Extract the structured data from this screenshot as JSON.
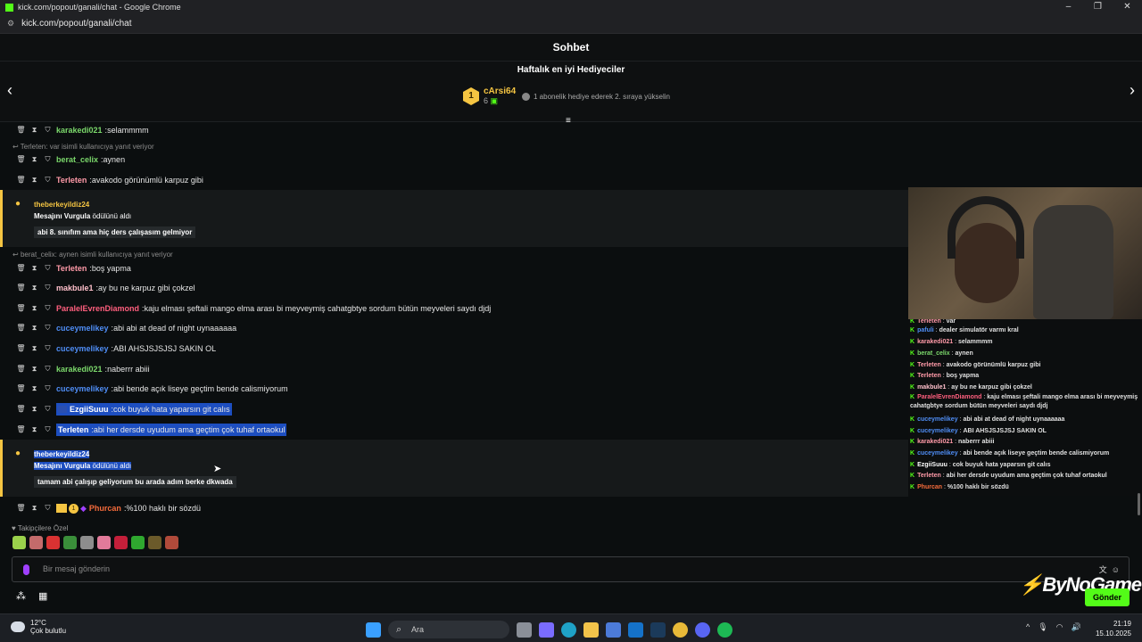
{
  "browser": {
    "window_title": "kick.com/popout/ganali/chat - Google Chrome",
    "url": "kick.com/popout/ganali/chat"
  },
  "header": {
    "title": "Sohbet"
  },
  "gifters": {
    "title": "Haftalık en iyi Hediyeciler",
    "top_rank": "1",
    "top_name": "cArsi64",
    "top_count": "6",
    "hint": "1 abonelik hediye ederek 2. sıraya yükselin"
  },
  "chat": {
    "messages": [
      {
        "user": "karakedi021",
        "text": "selammmm",
        "color": "#7bd86b"
      },
      {
        "user": "berat_celix",
        "text": "aynen",
        "color": "#7bd86b"
      },
      {
        "user": "Terleten",
        "text": "avakodo görünümlü karpuz gibi",
        "color": "#ff9aa8"
      },
      {
        "user": "Terleten",
        "text": "boş yapma",
        "color": "#ff9aa8"
      },
      {
        "user": "makbule1",
        "text": "ay bu ne karpuz gibi çokzel",
        "color": "#ffc0cb"
      },
      {
        "user": "ParalelEvrenDiamond",
        "text": "kaju elması şeftali mango elma arası bi meyveymiş cahatgbtye sordum bütün meyveleri saydı djdj",
        "color": "#ff5f7e"
      },
      {
        "user": "cuceymelikey",
        "text": "abi abi at dead of night uynaaaaaa",
        "color": "#4f8df5"
      },
      {
        "user": "cuceymelikey",
        "text": "ABI AHSJSJSJSJ SAKIN OL",
        "color": "#4f8df5"
      },
      {
        "user": "karakedi021",
        "text": "naberrr abiii",
        "color": "#7bd86b"
      },
      {
        "user": "cuceymelikey",
        "text": "abi bende açık liseye geçtim bende calismiyorum",
        "color": "#4f8df5"
      },
      {
        "user": "EzgiiSuuu",
        "text": "cok buyuk hata yaparsın git calıs",
        "color": "#ffffff"
      },
      {
        "user": "Terleten",
        "text": "abi her dersde uyudum ama geçtim çok tuhaf ortaokul",
        "color": "#ffffff"
      },
      {
        "user": "Phurcan",
        "text": "%100 haklı bir sözdü",
        "color": "#f56b3b"
      }
    ],
    "reply_1": "Terleten: var isimli kullanıcıya yanıt veriyor",
    "reply_2": "berat_celix: aynen isimli kullanıcıya yanıt veriyor",
    "highlight_1": {
      "user": "theberkeyildiz24",
      "reward": "Mesajını Vurgula",
      "reward_suffix": "ödülünü aldı",
      "body": "abi 8. sınıfım ama hiç ders çalışasım gelmiyor"
    },
    "highlight_2": {
      "user": "theberkeyildiz24",
      "reward": "Mesajını Vurgula",
      "reward_suffix": "ödülünü aldı",
      "body": "tamam abi çalışıp geliyorum bu arada adım berke dkwada"
    },
    "badge_number": "1"
  },
  "overlay_chat": [
    {
      "user": "Terleten",
      "text": "var"
    },
    {
      "user": "pafuli",
      "text": "dealer simulatör varmı kral"
    },
    {
      "user": "karakedi021",
      "text": "selammmm"
    },
    {
      "user": "berat_celix",
      "text": "aynen"
    },
    {
      "user": "Terleten",
      "text": "avakodo görünümlü karpuz gibi"
    },
    {
      "user": "Terleten",
      "text": "boş yapma"
    },
    {
      "user": "makbule1",
      "text": "ay bu ne karpuz gibi çokzel"
    },
    {
      "user": "ParalelEvrenDiamond",
      "text": "kaju elması şeftali mango elma arası bi meyveymiş cahatgbtye sordum bütün meyveleri saydı djdj"
    },
    {
      "user": "cuceymelikey",
      "text": "abi abi at dead of night uynaaaaaa"
    },
    {
      "user": "cuceymelikey",
      "text": "ABI AHSJSJSJSJ SAKIN OL"
    },
    {
      "user": "karakedi021",
      "text": "naberrr abiii"
    },
    {
      "user": "cuceymelikey",
      "text": "abi bende açık liseye geçtim bende calismiyorum"
    },
    {
      "user": "EzgiiSuuu",
      "text": "cok buyuk hata yaparsın git calıs"
    },
    {
      "user": "Terleten",
      "text": "abi her dersde uyudum ama geçtim çok tuhaf ortaokul"
    },
    {
      "user": "Phurcan",
      "text": "%100 haklı bir sözdü"
    }
  ],
  "followers_label": "Takipçilere Özel",
  "input": {
    "placeholder": "Bir mesaj gönderin"
  },
  "send_label": "Gönder",
  "watermark": "ByNoGame",
  "taskbar": {
    "weather_temp": "12°C",
    "weather_desc": "Çok bulutlu",
    "search": "Ara",
    "time": "21:19",
    "date": "15.10.2025"
  },
  "colors": {
    "accent": "#53fc18",
    "highlight": "#f5c542",
    "selection": "#1d4ec0"
  }
}
